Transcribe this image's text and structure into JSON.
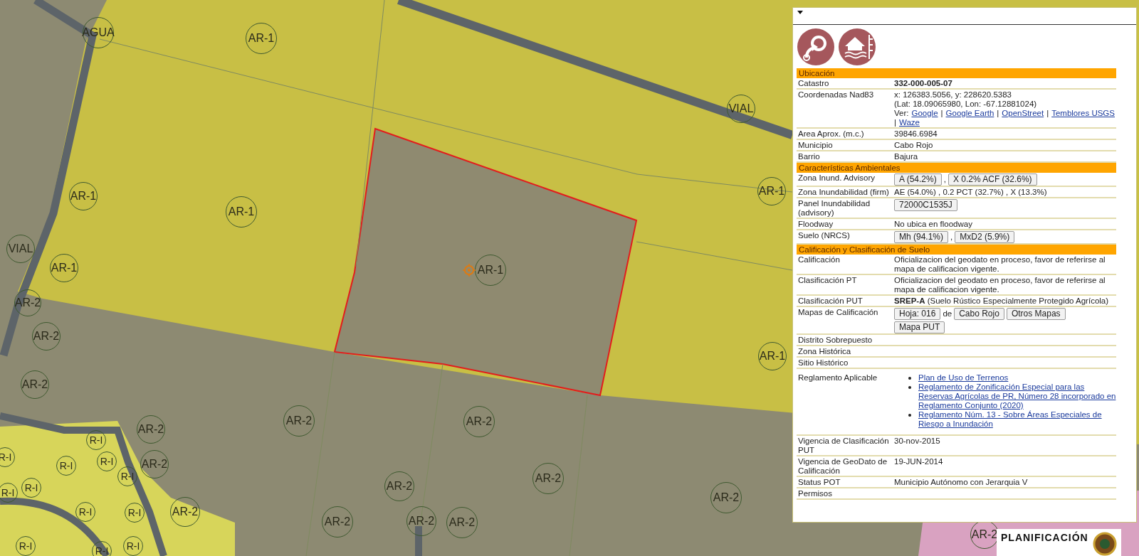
{
  "map": {
    "zone_labels": [
      {
        "text": "AGUA"
      },
      {
        "text": "AR-1"
      },
      {
        "text": "VIAL"
      },
      {
        "text": "AR-1"
      },
      {
        "text": "AR-1"
      },
      {
        "text": "VIAL"
      },
      {
        "text": "AR-1"
      },
      {
        "text": "AR-1"
      },
      {
        "text": "AR-1"
      },
      {
        "text": "AR-1"
      },
      {
        "text": "AR-2"
      },
      {
        "text": "AR-2"
      },
      {
        "text": "AR-2"
      },
      {
        "text": "AR-2"
      },
      {
        "text": "AR-2"
      },
      {
        "text": "AR-2"
      },
      {
        "text": "AR-2"
      },
      {
        "text": "AR-2"
      },
      {
        "text": "AR-2"
      },
      {
        "text": "AR-2"
      },
      {
        "text": "AR-2"
      },
      {
        "text": "AR-2"
      },
      {
        "text": "AR-2"
      },
      {
        "text": "AR-2"
      },
      {
        "text": "AR-2"
      },
      {
        "text": "R-I"
      },
      {
        "text": "R-I"
      },
      {
        "text": "R-I"
      },
      {
        "text": "R-I"
      },
      {
        "text": "R-I"
      },
      {
        "text": "R-I"
      },
      {
        "text": "R-I"
      },
      {
        "text": "R-I"
      },
      {
        "text": "R-I"
      },
      {
        "text": "R-I"
      },
      {
        "text": "R-I"
      },
      {
        "text": "R-I"
      }
    ],
    "logo_text": "PLANIFICACIÓN"
  },
  "panel": {
    "sections": [
      {
        "title": "Ubicación",
        "rows": [
          {
            "label": "Catastro",
            "kind": "bold",
            "value": "332-000-005-07"
          },
          {
            "label": "Coordenadas Nad83",
            "kind": "coords",
            "lines": [
              "x: 126383.5056, y: 228620.5383",
              "(Lat: 18.09065980, Lon: -67.12881024)"
            ],
            "prefix": "Ver:",
            "separator": "|",
            "links": [
              "Google",
              "Google Earth",
              "OpenStreet",
              "Temblores USGS",
              "Waze"
            ]
          },
          {
            "label": "Area Aprox. (m.c.)",
            "kind": "text",
            "value": "39846.6984"
          },
          {
            "label": "Municipio",
            "kind": "text",
            "value": "Cabo Rojo"
          },
          {
            "label": "Barrio",
            "kind": "text",
            "value": "Bajura"
          }
        ]
      },
      {
        "title": "Características Ambientales",
        "rows": [
          {
            "label": "Zona Inund. Advisory",
            "kind": "items",
            "items": [
              {
                "kind": "button",
                "text": "A (54.2%)"
              },
              {
                "kind": "text",
                "text": ","
              },
              {
                "kind": "button",
                "text": "X 0.2% ACF (32.6%)"
              }
            ]
          },
          {
            "label": "Zona Inundabilidad (firm)",
            "kind": "text",
            "value": "AE (54.0%) , 0.2 PCT (32.7%) , X (13.3%)"
          },
          {
            "label": "Panel Inundabilidad (advisory)",
            "kind": "items",
            "items": [
              {
                "kind": "button",
                "text": "72000C1535J"
              }
            ]
          },
          {
            "label": "Floodway",
            "kind": "text",
            "value": "No ubica en floodway"
          },
          {
            "label": "Suelo (NRCS)",
            "kind": "items",
            "items": [
              {
                "kind": "button",
                "text": "Mh (94.1%)"
              },
              {
                "kind": "text",
                "text": ","
              },
              {
                "kind": "button",
                "text": "MxD2 (5.9%)"
              }
            ]
          }
        ]
      },
      {
        "title": "Calificación y Clasificación de Suelo",
        "rows": [
          {
            "label": "Calificación",
            "kind": "text",
            "value": "Oficializacion del geodato en proceso, favor de referirse al mapa de calificacion vigente."
          },
          {
            "label": "Clasificación PT",
            "kind": "text",
            "value": "Oficializacion del geodato en proceso, favor de referirse al mapa de calificacion vigente."
          },
          {
            "label": "Clasificación PUT",
            "kind": "text",
            "value": "**SREP-A** (Suelo Rústico Especialmente Protegido Agrícola)"
          },
          {
            "label": "Mapas de Calificación",
            "kind": "items",
            "items": [
              {
                "kind": "button",
                "text": "Hoja: 016"
              },
              {
                "kind": "text",
                "text": "de"
              },
              {
                "kind": "button",
                "text": "Cabo Rojo"
              },
              {
                "kind": "button",
                "text": "Otros Mapas"
              },
              {
                "kind": "button",
                "text": "Mapa PUT"
              }
            ]
          },
          {
            "label": "Distrito Sobrepuesto",
            "kind": "text"
          },
          {
            "label": "Zona Histórica",
            "kind": "text"
          },
          {
            "label": "Sitio Histórico",
            "kind": "text"
          },
          {
            "label": "Reglamento Aplicable",
            "kind": "list",
            "links": [
              "Plan de Uso de Terrenos",
              "Reglamento de Zonificación Especial para las Reservas Agrícolas de PR, Número 28 incorporado en Reglamento Conjunto (2020)",
              "Reglamento Núm. 13 - Sobre Áreas Especiales de Riesgo a Inundación"
            ]
          },
          {
            "label": "Vigencia de Clasificación PUT",
            "kind": "text",
            "value": "30-nov-2015"
          },
          {
            "label": "Vigencia de GeoDato de Calificación",
            "kind": "text",
            "value": "19-JUN-2014"
          },
          {
            "label": "Status POT",
            "kind": "text",
            "value": "Municipio Autónomo con Jerarquia V"
          },
          {
            "label": "Permisos",
            "kind": "text"
          }
        ]
      }
    ]
  }
}
